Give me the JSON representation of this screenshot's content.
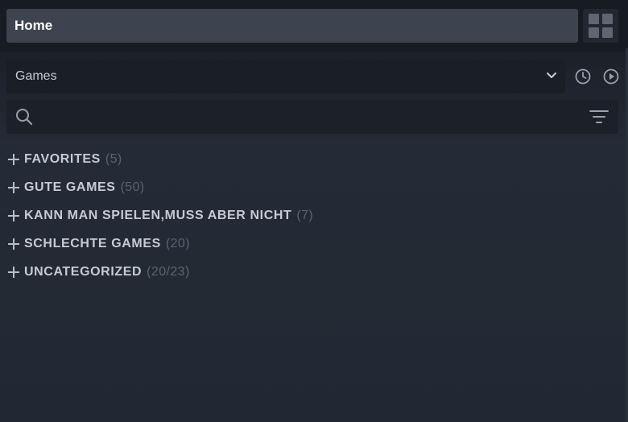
{
  "header": {
    "home_label": "Home",
    "grid_view_icon": "grid-view-icon"
  },
  "collection": {
    "selected": "Games",
    "dropdown_icon": "chevron-down-icon",
    "recent_icon": "clock-icon",
    "play_icon": "play-circle-icon"
  },
  "search": {
    "placeholder": "",
    "value": "",
    "search_icon": "search-icon",
    "filter_icon": "filter-icon"
  },
  "categories": [
    {
      "name": "FAVORITES",
      "count": "(5)"
    },
    {
      "name": "GUTE GAMES",
      "count": "(50)"
    },
    {
      "name": "KANN MAN SPIELEN,MUSS ABER NICHT",
      "count": "(7)"
    },
    {
      "name": "SCHLECHTE GAMES",
      "count": "(20)"
    },
    {
      "name": "UNCATEGORIZED",
      "count": "(20/23)"
    }
  ],
  "colors": {
    "background": "#1e232c",
    "home_button": "#3d4450",
    "text": "#c6cbd3",
    "muted_count": "#5c6370"
  }
}
